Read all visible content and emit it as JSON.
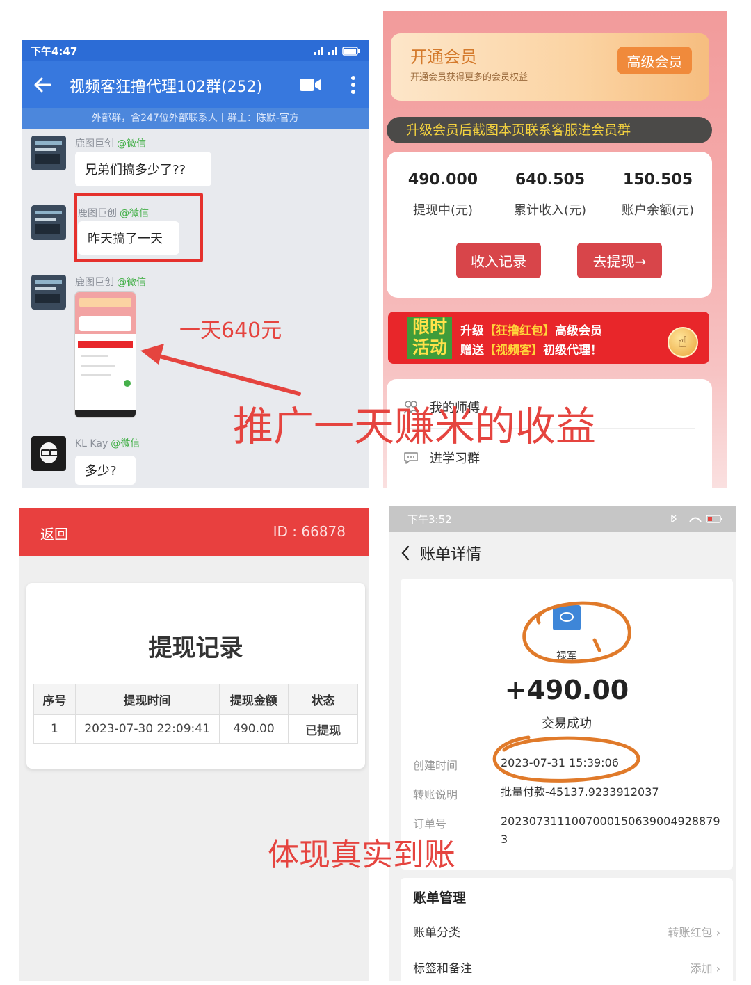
{
  "chat_panel": {
    "status_time": "下午4:47",
    "title": "视频客狂撸代理102群(252)",
    "subtitle": "外部群，含247位外部联系人丨群主：陈默-官方",
    "messages": [
      {
        "sender": "鹿图巨创",
        "tag": "@微信",
        "text": "兄弟们搞多少了??"
      },
      {
        "sender": "鹿图巨创",
        "tag": "@微信",
        "text": "昨天搞了一天"
      },
      {
        "sender": "鹿图巨创",
        "tag": "@微信",
        "type": "image"
      },
      {
        "sender": "KL Kay",
        "tag": "@微信",
        "text": "多少?"
      }
    ],
    "annotation": "一天640元",
    "icons": [
      "back-arrow-icon",
      "video-call-icon",
      "more-vertical-icon",
      "signal-icon",
      "battery-icon"
    ]
  },
  "member_panel": {
    "promo_title": "开通会员",
    "promo_subtitle": "开通会员获得更多的会员权益",
    "promo_button": "高级会员",
    "notice": "升级会员后截图本页联系客服进会员群",
    "stats": [
      {
        "value": "490.000",
        "label": "提现中(元)"
      },
      {
        "value": "640.505",
        "label": "累计收入(元)"
      },
      {
        "value": "150.505",
        "label": "账户余额(元)"
      }
    ],
    "income_button": "收入记录",
    "withdraw_button": "去提现→",
    "banner": {
      "badge_line1": "限时",
      "badge_line2": "活动",
      "line1": {
        "pre": "升级",
        "highlight": "【狂撸红包】",
        "post": "高级会员"
      },
      "line2": {
        "pre": "赠送",
        "highlight": "【视频客】",
        "post": "初级代理！"
      }
    },
    "menu": [
      {
        "label": "我的师傅",
        "icon": "people-icon"
      },
      {
        "label": "进学习群",
        "icon": "chat-bubble-icon"
      }
    ]
  },
  "overlay_top": "推广一天赚米的收益",
  "withdraw_panel": {
    "back": "返回",
    "id_label": "ID : 66878",
    "title": "提现记录",
    "headers": [
      "序号",
      "提现时间",
      "提现金额",
      "状态"
    ],
    "rows": [
      {
        "index": "1",
        "time": "2023-07-30 22:09:41",
        "amount": "490.00",
        "status": "已提现"
      }
    ]
  },
  "bill_panel": {
    "status_time": "下午3:52",
    "title": "账单详情",
    "name": "禄军",
    "amount": "+490.00",
    "state": "交易成功",
    "details": [
      {
        "label": "创建时间",
        "value": "2023-07-31 15:39:06"
      },
      {
        "label": "转账说明",
        "value": "批量付款-45137.9233912037"
      },
      {
        "label": "订单号",
        "value": "20230731110070001506390049288793"
      }
    ],
    "section": "账单管理",
    "rows": [
      {
        "label": "账单分类",
        "value": "转账红包"
      },
      {
        "label": "标签和备注",
        "value": "添加"
      }
    ]
  },
  "overlay_bottom": "体现真实到账",
  "colors": {
    "chat_blue": "#3778de",
    "accent_red": "#e5443f",
    "promo_orange": "#f08a3b",
    "success_green": "#2ea34c",
    "marker_orange": "#e07a2a"
  }
}
